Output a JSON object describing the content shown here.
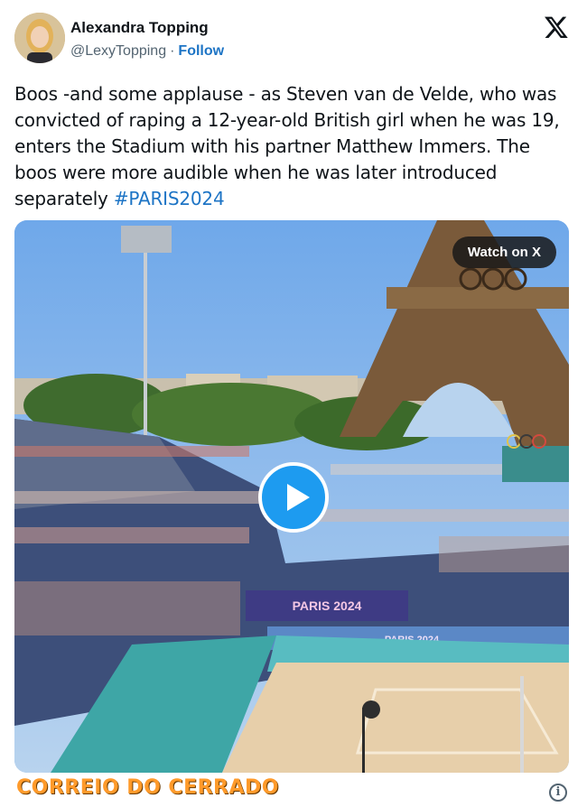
{
  "author": {
    "name": "Alexandra Topping",
    "handle": "@LexyTopping",
    "separator": "·",
    "follow_label": "Follow"
  },
  "tweet": {
    "text": "Boos -and some applause - as Steven van de Velde, who was convicted of raping a 12-year-old British girl when he was 19, enters the Stadium with his partner Matthew Immers. The boos were more audible when he was later introduced separately ",
    "hashtag": "#PARIS2024"
  },
  "media": {
    "watch_label": "Watch on X",
    "banner_text": "PARIS 2024",
    "banner_text_small": "PARIS 2024"
  },
  "footer": {
    "watermark": "CORREIO DO CERRADO",
    "info_symbol": "i"
  },
  "icons": [
    "x-logo-icon",
    "play-icon",
    "info-icon"
  ],
  "colors": {
    "link": "#1d74c5",
    "play_button": "#1d9bf0",
    "watermark": "#ff9a2a"
  }
}
